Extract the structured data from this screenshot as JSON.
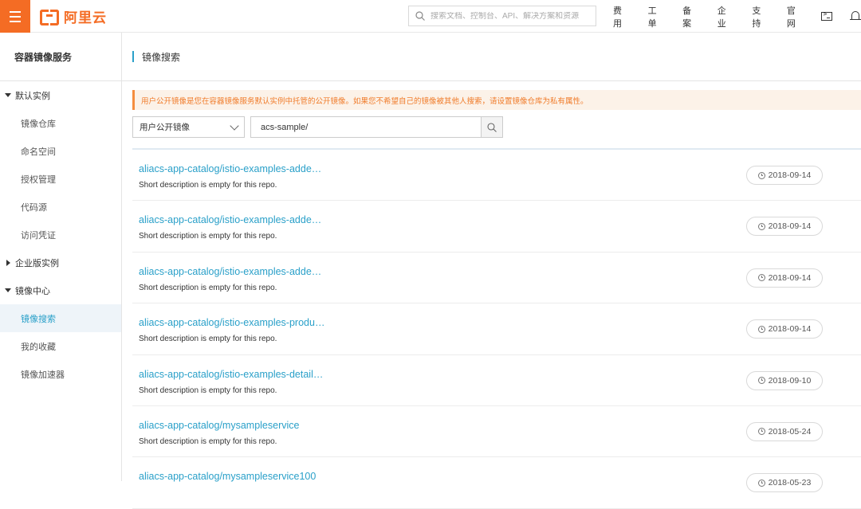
{
  "topbar": {
    "brand": "阿里云",
    "search_placeholder": "搜索文档、控制台、API、解决方案和资源",
    "nav": [
      "费用",
      "工单",
      "备案",
      "企业",
      "支持",
      "官网"
    ]
  },
  "sidebar": {
    "title": "容器镜像服务",
    "groups": [
      {
        "label": "默认实例",
        "expanded": true,
        "items": [
          "镜像仓库",
          "命名空间",
          "授权管理",
          "代码源",
          "访问凭证"
        ]
      },
      {
        "label": "企业版实例",
        "expanded": false,
        "items": []
      },
      {
        "label": "镜像中心",
        "expanded": true,
        "items": [
          "镜像搜索",
          "我的收藏",
          "镜像加速器"
        ]
      }
    ],
    "active_item": "镜像搜索"
  },
  "main": {
    "page_title": "镜像搜索",
    "notice": "用户公开镜像是您在容器镜像服务默认实例中托管的公开镜像。如果您不希望自己的镜像被其他人搜索，请设置镜像仓库为私有属性。",
    "filter_select": "用户公开镜像",
    "query_value": "acs-sample/",
    "results": [
      {
        "name": "aliacs-app-catalog/istio-examples-adde…",
        "desc": "Short description is empty for this repo.",
        "date": "2018-09-14"
      },
      {
        "name": "aliacs-app-catalog/istio-examples-adde…",
        "desc": "Short description is empty for this repo.",
        "date": "2018-09-14"
      },
      {
        "name": "aliacs-app-catalog/istio-examples-adde…",
        "desc": "Short description is empty for this repo.",
        "date": "2018-09-14"
      },
      {
        "name": "aliacs-app-catalog/istio-examples-produ…",
        "desc": "Short description is empty for this repo.",
        "date": "2018-09-14"
      },
      {
        "name": "aliacs-app-catalog/istio-examples-detail…",
        "desc": "Short description is empty for this repo.",
        "date": "2018-09-10"
      },
      {
        "name": "aliacs-app-catalog/mysampleservice",
        "desc": "Short description is empty for this repo.",
        "date": "2018-05-24"
      },
      {
        "name": "aliacs-app-catalog/mysampleservice100",
        "desc": "",
        "date": "2018-05-23"
      }
    ]
  },
  "colors": {
    "brand": "#f46c24",
    "link": "#2aa0c9",
    "notice_bg": "#fcf2e8",
    "notice_text": "#f07c2b"
  },
  "icons": {
    "menu": "hamburger-icon",
    "search": "search-icon",
    "terminal": "terminal-icon",
    "bell": "bell-icon",
    "clock": "clock-icon"
  }
}
